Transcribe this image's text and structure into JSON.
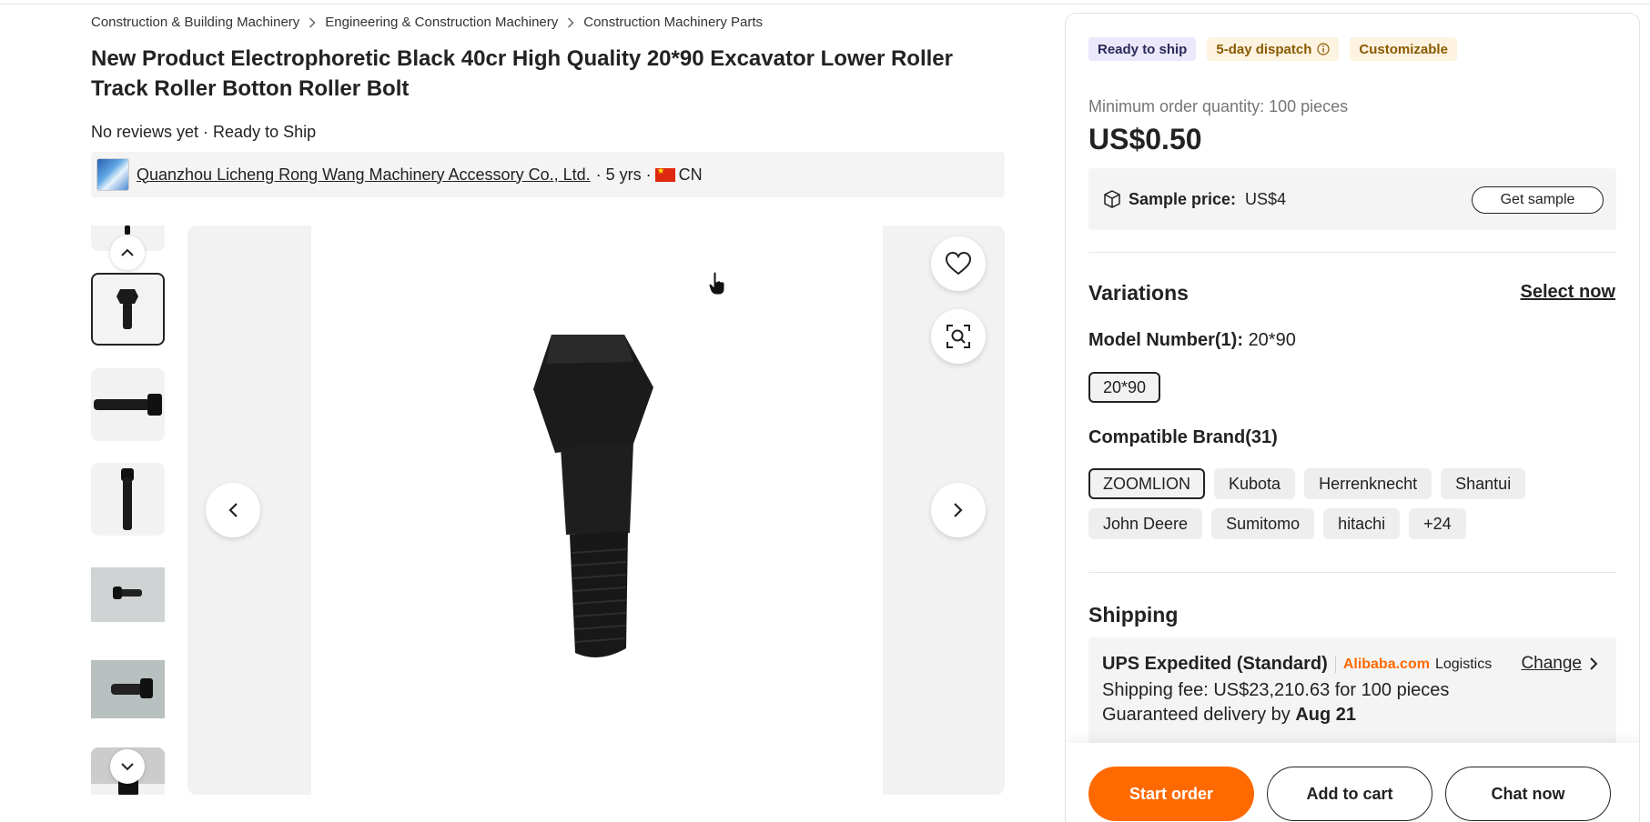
{
  "breadcrumb": [
    "Construction & Building Machinery",
    "Engineering & Construction Machinery",
    "Construction Machinery Parts"
  ],
  "product": {
    "title": "New Product Electrophoretic Black 40cr High Quality 20*90 Excavator Lower Roller Track Roller Botton Roller Bolt",
    "meta": "No reviews yet · Ready to Ship"
  },
  "supplier": {
    "name": "Quanzhou Licheng Rong Wang Machinery Accessory Co., Ltd.",
    "years": "· 5 yrs ·",
    "country": "CN"
  },
  "badges": {
    "ready": "Ready to ship",
    "dispatch": "5-day dispatch",
    "custom": "Customizable"
  },
  "pricing": {
    "moq": "Minimum order quantity: 100 pieces",
    "price": "US$0.50",
    "sample_label": "Sample price:",
    "sample_value": "US$4",
    "sample_button": "Get sample"
  },
  "variations": {
    "title": "Variations",
    "select_now": "Select now",
    "model_label": "Model Number(1):",
    "model_value": "20*90",
    "models": [
      "20*90"
    ],
    "brand_label": "Compatible Brand(31)",
    "brands": [
      "ZOOMLION",
      "Kubota",
      "Herrenknecht",
      "Shantui",
      "John Deere",
      "Sumitomo",
      "hitachi",
      "+24"
    ]
  },
  "shipping": {
    "title": "Shipping",
    "method": "UPS Expedited (Standard)",
    "carrier_brand": "Alibaba.com",
    "carrier_suffix": "Logistics",
    "change": "Change",
    "fee": "Shipping fee: US$23,210.63 for 100 pieces",
    "delivery_prefix": "Guaranteed delivery by",
    "delivery_date": "Aug 21"
  },
  "actions": {
    "start_order": "Start order",
    "add_to_cart": "Add to cart",
    "chat_now": "Chat now"
  },
  "colors": {
    "accent": "#ff6a00",
    "ready_bg": "#ebe8fb",
    "dispatch_bg": "#fdf3e0"
  }
}
